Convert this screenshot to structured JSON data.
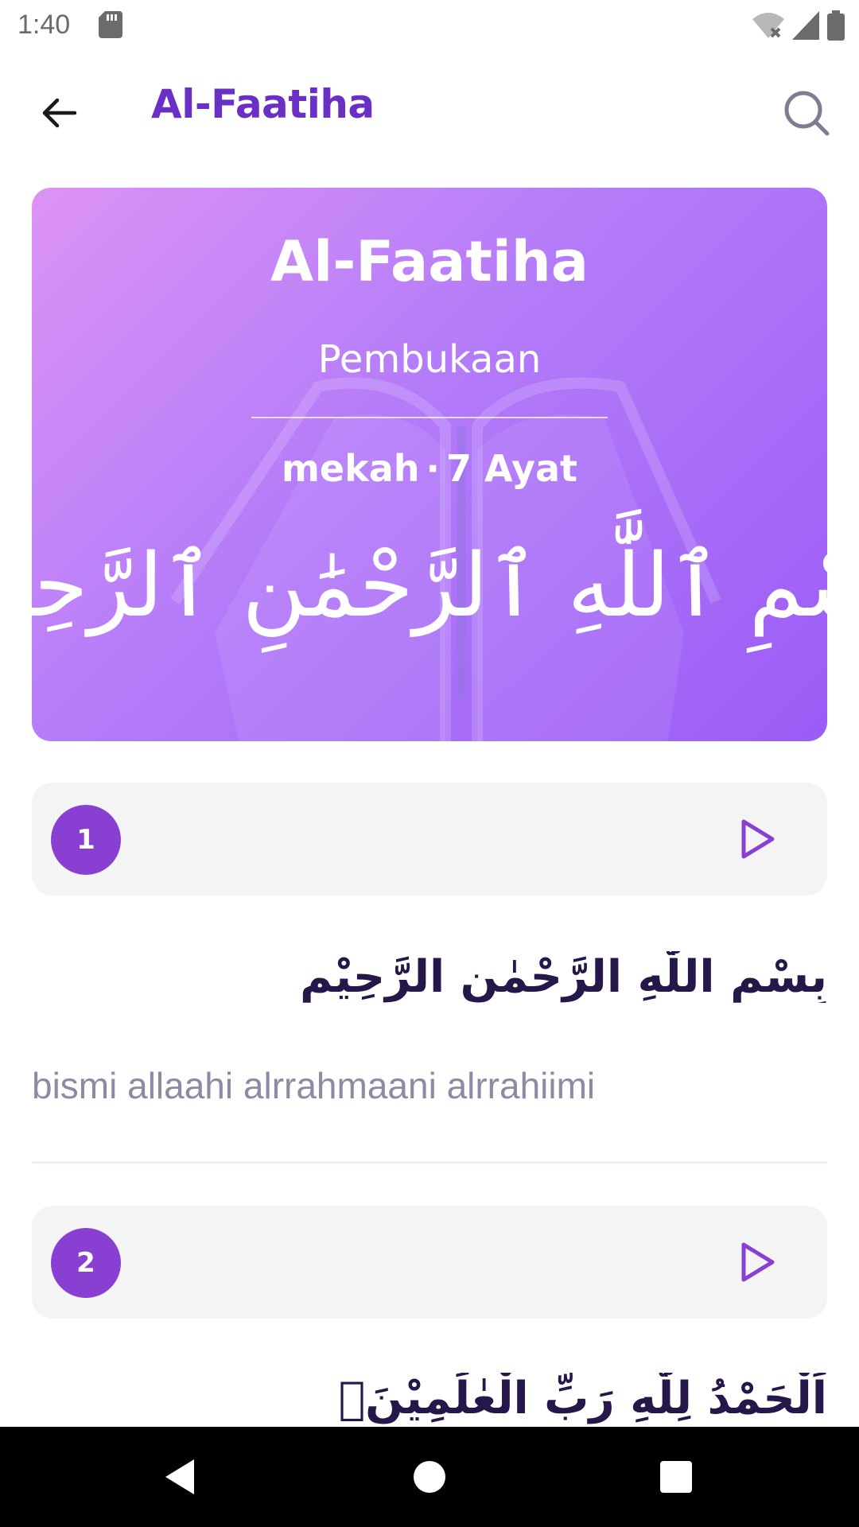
{
  "status_bar": {
    "time": "1:40",
    "icons": [
      "sd-card-icon",
      "wifi-off-icon",
      "signal-icon",
      "battery-icon"
    ]
  },
  "app_bar": {
    "title": "Al-Faatiha",
    "back_icon": "arrow-back-icon",
    "search_icon": "search-icon",
    "title_color": "#6a2fc4"
  },
  "surah_card": {
    "name": "Al-Faatiha",
    "translation": "Pembukaan",
    "revelation": "mekah",
    "separator": "·",
    "ayah_count": "7 Ayat",
    "basmalah": "بِسْمِ ٱللَّٰهِ ٱلرَّحْمَٰنِ ٱلرَّحِيمِ",
    "gradient": [
      "#dc93f5",
      "#b37bf9",
      "#9b5cf6"
    ]
  },
  "ayahs": [
    {
      "number": "1",
      "arabic": "بِسْمِ اللّٰهِ الرَّحْمٰنِ الرَّحِيْمِ",
      "latin": "bismi allaahi alrrahmaani alrrahiimi"
    },
    {
      "number": "2",
      "arabic": "اَلْحَمْدُ لِلّٰهِ رَبِّ الْعٰلَمِيْنَۙ"
    }
  ],
  "colors": {
    "accent": "#8a3fd3",
    "arabic_text": "#26174a",
    "latin_text": "#8c8ba4",
    "ayah_bar_bg": "#f4f4f4"
  },
  "nav_bar": {
    "icons": [
      "nav-back-icon",
      "nav-home-icon",
      "nav-recents-icon"
    ]
  }
}
